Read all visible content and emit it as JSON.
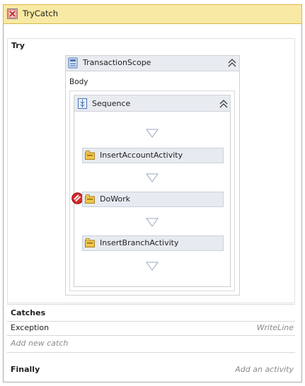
{
  "trycatch": {
    "title": "TryCatch",
    "icon": "trycatch-icon"
  },
  "try": {
    "label": "Try",
    "transaction_scope": {
      "title": "TransactionScope",
      "icon": "transaction-scope-icon",
      "body_label": "Body",
      "sequence": {
        "title": "Sequence",
        "icon": "sequence-icon",
        "activities": [
          {
            "label": "InsertAccountActivity",
            "icon": "activity-folder-icon",
            "error": false
          },
          {
            "label": "DoWork",
            "icon": "activity-folder-icon",
            "error": true
          },
          {
            "label": "InsertBranchActivity",
            "icon": "activity-folder-icon",
            "error": false
          }
        ]
      }
    }
  },
  "catches": {
    "label": "Catches",
    "items": [
      {
        "exception": "Exception",
        "action": "WriteLine"
      }
    ],
    "add_new": "Add new catch"
  },
  "finally": {
    "label": "Finally",
    "action": "Add an activity"
  },
  "colors": {
    "header_yellow": "#f8e9a4",
    "header_border": "#d8b54e",
    "activity_bg": "#e7ebf1",
    "hint_text": "#8a8a8a",
    "error_red": "#d9262a"
  }
}
